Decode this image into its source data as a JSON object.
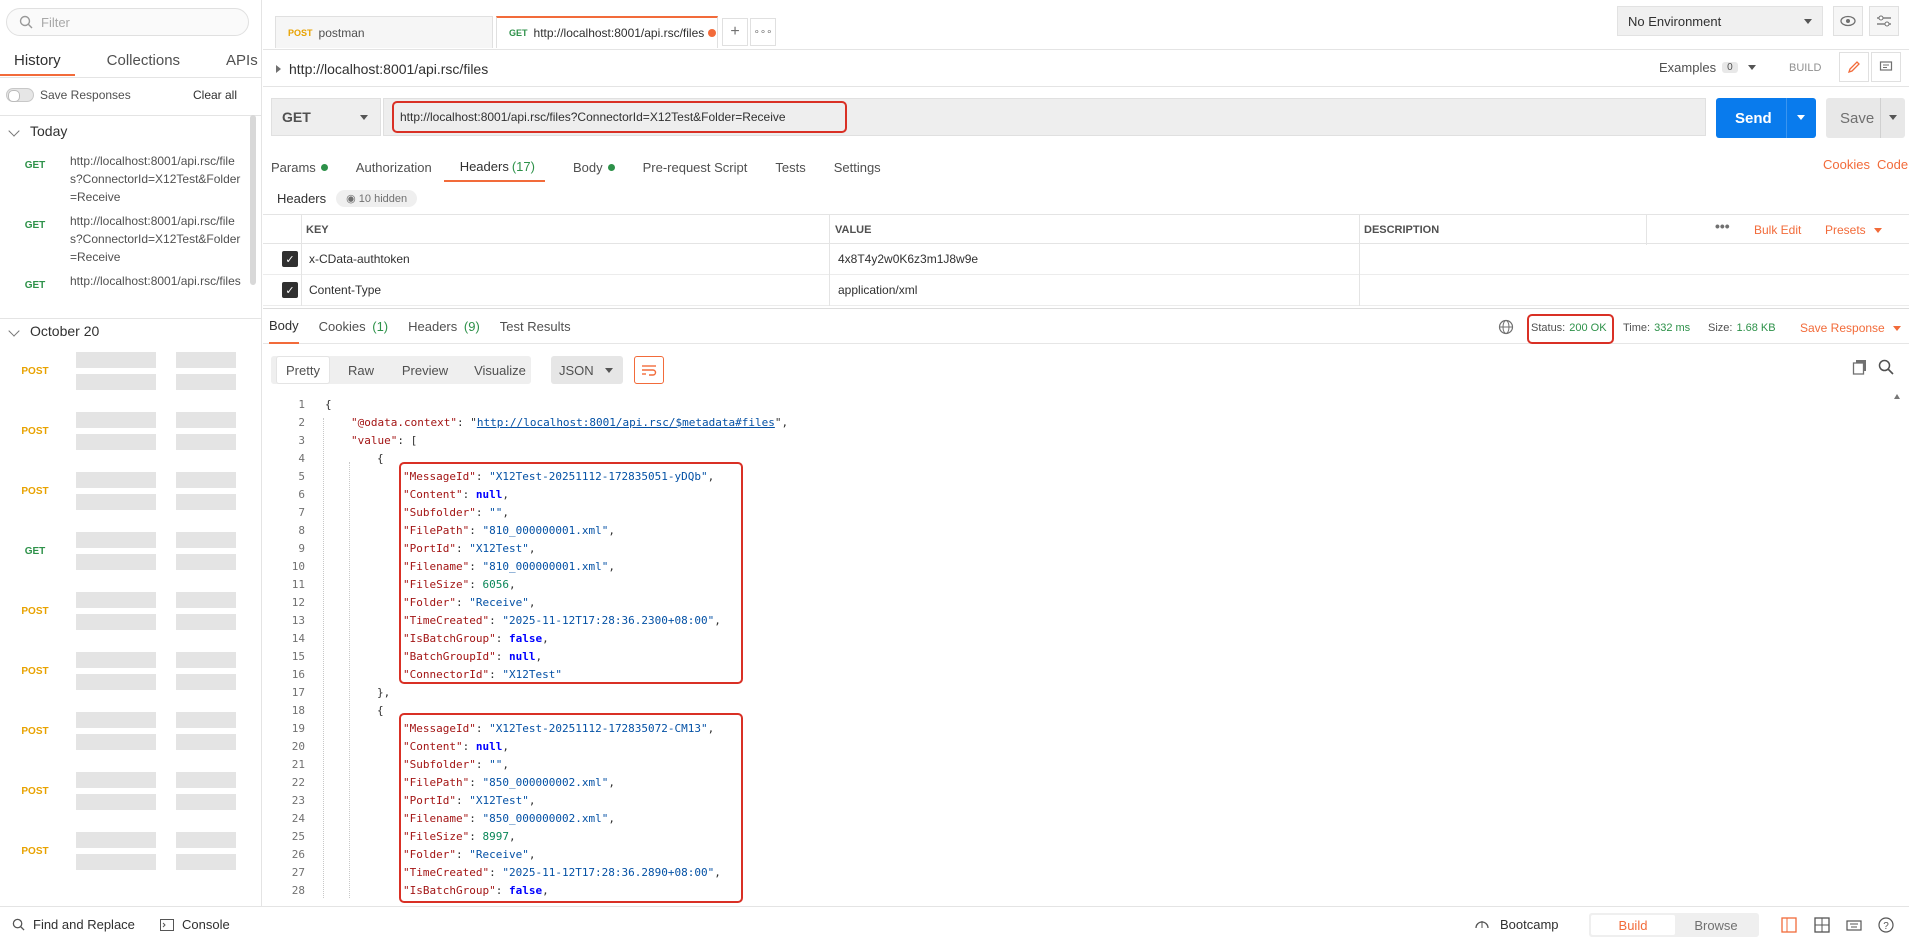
{
  "sidebar": {
    "filter_placeholder": "Filter",
    "tabs": [
      "History",
      "Collections",
      "APIs"
    ],
    "save_responses": "Save Responses",
    "clear_all": "Clear all",
    "groups": {
      "today": "Today",
      "oct20": "October 20"
    },
    "today_items": [
      {
        "method": "GET",
        "url": "http://localhost:8001/api.rsc/files?ConnectorId=X12Test&Folder=Receive"
      },
      {
        "method": "GET",
        "url": "http://localhost:8001/api.rsc/files?ConnectorId=X12Test&Folder=Receive"
      },
      {
        "method": "GET",
        "url": "http://localhost:8001/api.rsc/files"
      }
    ],
    "oct20_methods": [
      "POST",
      "POST",
      "POST",
      "GET",
      "POST",
      "POST",
      "POST",
      "POST",
      "POST"
    ]
  },
  "tabs": {
    "tab1": {
      "method": "POST",
      "label": "postman"
    },
    "tab2": {
      "method": "GET",
      "label": "http://localhost:8001/api.rsc/files"
    }
  },
  "env": {
    "label": "No Environment"
  },
  "request": {
    "breadcrumb": "http://localhost:8001/api.rsc/files",
    "examples_label": "Examples",
    "examples_count": "0",
    "build_label": "BUILD",
    "method": "GET",
    "url": "http://localhost:8001/api.rsc/files?ConnectorId=X12Test&Folder=Receive",
    "send": "Send",
    "save": "Save",
    "tabs": {
      "params": "Params",
      "auth": "Authorization",
      "headers": "Headers",
      "headers_count": "(17)",
      "body": "Body",
      "prerequest": "Pre-request Script",
      "tests": "Tests",
      "settings": "Settings"
    },
    "cookies_link": "Cookies",
    "code_link": "Code",
    "headers_label": "Headers",
    "hidden_label": "10 hidden",
    "table": {
      "col_key": "KEY",
      "col_value": "VALUE",
      "col_desc": "DESCRIPTION",
      "bulk_edit": "Bulk Edit",
      "presets": "Presets",
      "rows": [
        {
          "key": "x-CData-authtoken",
          "value": "4x8T4y2w0K6z3m1J8w9e"
        },
        {
          "key": "Content-Type",
          "value": "application/xml"
        }
      ]
    }
  },
  "response": {
    "tabs": {
      "body": "Body",
      "cookies": "Cookies",
      "cookies_count": "(1)",
      "headers": "Headers",
      "headers_count": "(9)",
      "tests": "Test Results"
    },
    "status_label": "Status:",
    "status_value": "200 OK",
    "time_label": "Time:",
    "time_value": "332 ms",
    "size_label": "Size:",
    "size_value": "1.68 KB",
    "save_response": "Save Response",
    "formats": [
      "Pretty",
      "Raw",
      "Preview",
      "Visualize"
    ],
    "format_select": "JSON",
    "lines": [
      "{",
      "\"@odata.context\": \"http://localhost:8001/api.rsc/$metadata#files\",",
      "\"value\": [",
      "{",
      "\"MessageId\": \"X12Test-20251112-172835051-yDQb\",",
      "\"Content\": null,",
      "\"Subfolder\": \"\",",
      "\"FilePath\": \"810_000000001.xml\",",
      "\"PortId\": \"X12Test\",",
      "\"Filename\": \"810_000000001.xml\",",
      "\"FileSize\": 6056,",
      "\"Folder\": \"Receive\",",
      "\"TimeCreated\": \"2025-11-12T17:28:36.2300+08:00\",",
      "\"IsBatchGroup\": false,",
      "\"BatchGroupId\": null,",
      "\"ConnectorId\": \"X12Test\"",
      "},",
      "{",
      "\"MessageId\": \"X12Test-20251112-172835072-CM13\",",
      "\"Content\": null,",
      "\"Subfolder\": \"\",",
      "\"FilePath\": \"850_000000002.xml\",",
      "\"PortId\": \"X12Test\",",
      "\"Filename\": \"850_000000002.xml\",",
      "\"FileSize\": 8997,",
      "\"Folder\": \"Receive\",",
      "\"TimeCreated\": \"2025-11-12T17:28:36.2890+08:00\",",
      "\"IsBatchGroup\": false,"
    ]
  },
  "statusbar": {
    "find_replace": "Find and Replace",
    "console": "Console",
    "bootcamp": "Bootcamp",
    "build": "Build",
    "browse": "Browse"
  },
  "colors": {
    "accent": "#f26b3a",
    "send": "#097bed",
    "get": "#2d9149",
    "post": "#e8a200",
    "highlight": "#d93025"
  }
}
